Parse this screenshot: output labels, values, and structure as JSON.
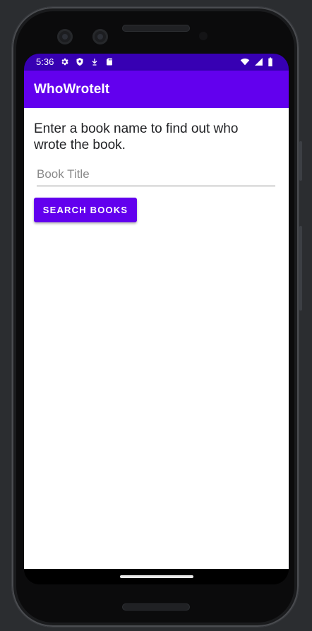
{
  "status_bar": {
    "time": "5:36",
    "left_icons": [
      "settings-icon",
      "shield-icon",
      "download-arrow-icon",
      "sd-card-icon"
    ],
    "right_icons": [
      "wifi-icon",
      "cell-signal-icon",
      "battery-icon"
    ],
    "color": "#3700b3"
  },
  "app_bar": {
    "title": "WhoWroteIt",
    "color": "#6200ee"
  },
  "main": {
    "prompt": "Enter a book name to find out who wrote the book.",
    "book_input": {
      "value": "",
      "placeholder": "Book Title"
    },
    "search_button_label": "SEARCH BOOKS"
  }
}
